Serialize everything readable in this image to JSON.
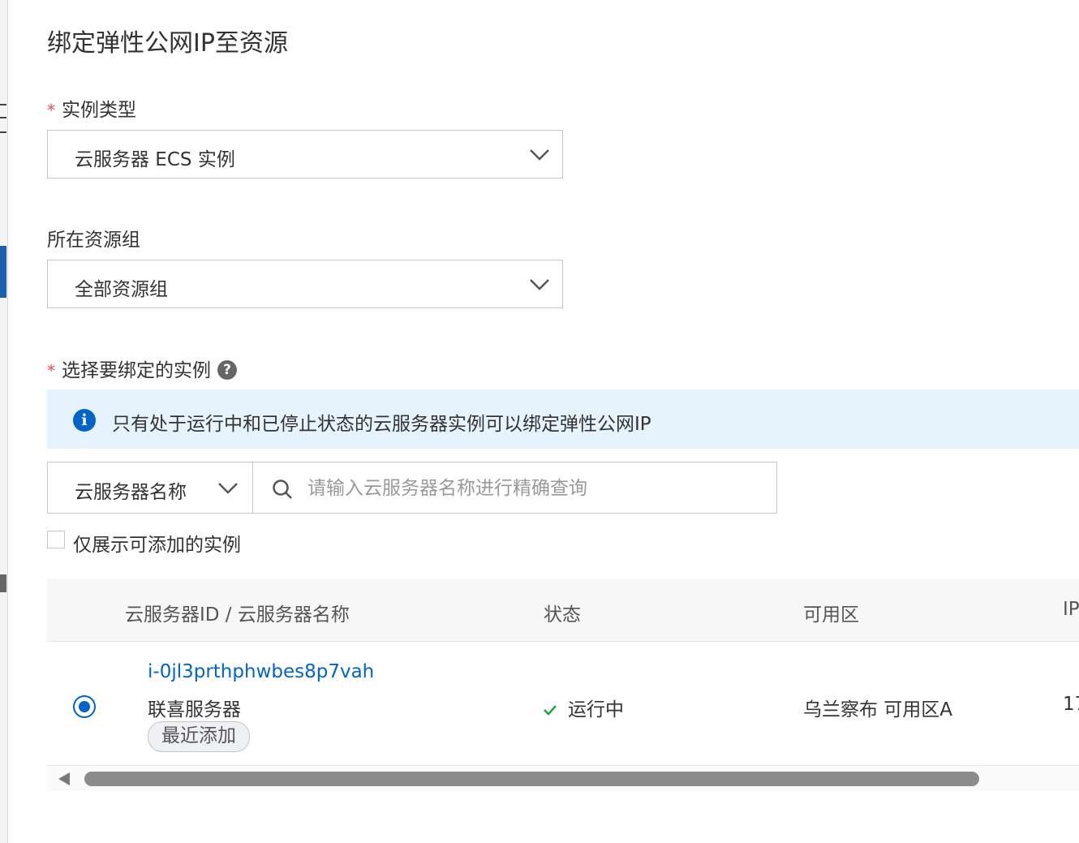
{
  "dialog": {
    "title": "绑定弹性公网IP至资源",
    "instance_type": {
      "required_mark": "*",
      "label": "实例类型",
      "value": "云服务器 ECS 实例"
    },
    "resource_group": {
      "label": "所在资源组",
      "value": "全部资源组"
    },
    "select_instance": {
      "required_mark": "*",
      "label": "选择要绑定的实例",
      "help_icon": "?"
    },
    "notice": {
      "icon": "i",
      "text": "只有处于运行中和已停止状态的云服务器实例可以绑定弹性公网IP"
    },
    "search": {
      "field": "云服务器名称",
      "placeholder": "请输入云服务器名称进行精确查询",
      "value": ""
    },
    "filter_checkbox": {
      "label": "仅展示可添加的实例",
      "checked": false
    },
    "table": {
      "columns": [
        "云服务器ID / 云服务器名称",
        "状态",
        "可用区",
        "IP"
      ],
      "rows": [
        {
          "selected": true,
          "id": "i-0jl3prthphwbes8p7vah",
          "name": "联喜服务器",
          "tag": "最近添加",
          "status": "运行中",
          "zone": "乌兰察布 可用区A",
          "ip_partial": "17"
        }
      ]
    }
  },
  "colors": {
    "primary": "#0064c8",
    "notice_bg": "#e6f2fc",
    "required": "#e5484d",
    "success": "#1ba734"
  }
}
